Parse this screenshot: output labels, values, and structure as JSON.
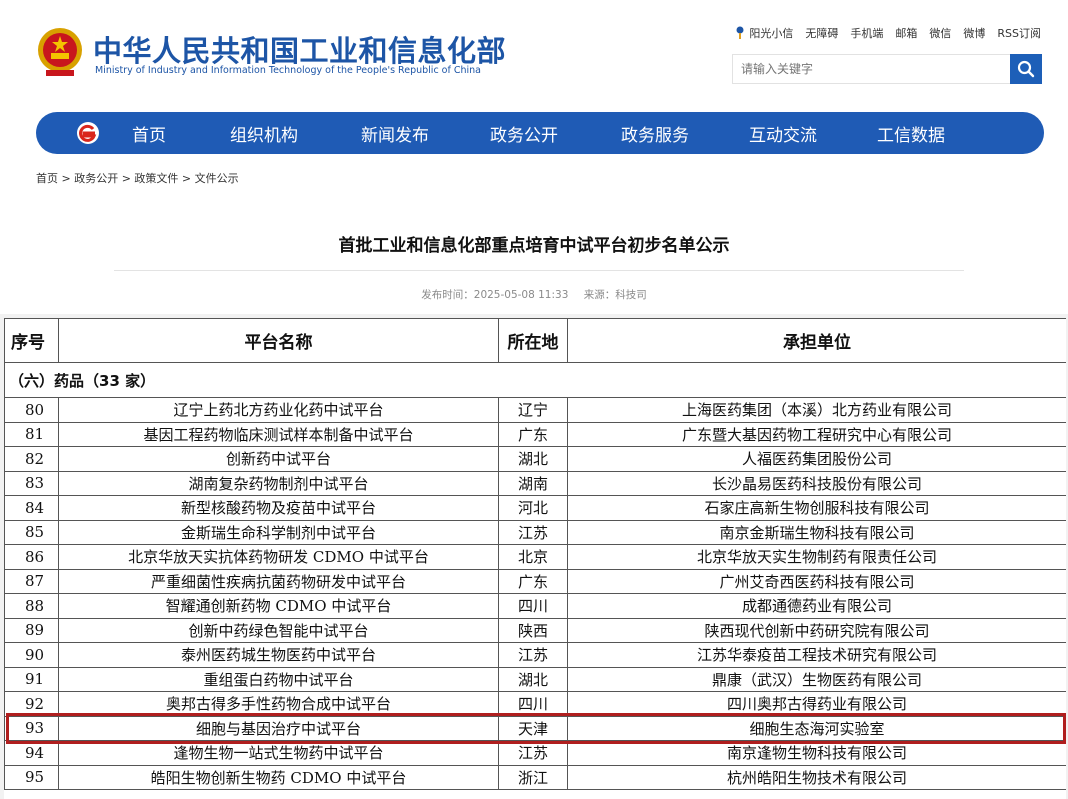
{
  "header": {
    "ministry_cn": "中华人民共和国工业和信息化部",
    "ministry_en": "Ministry of Industry and Information Technology of the People's Republic of China",
    "top_links": [
      "阳光小信",
      "无障碍",
      "手机端",
      "邮箱",
      "微信",
      "微博",
      "RSS订阅"
    ],
    "search": {
      "placeholder": "请输入关键字"
    }
  },
  "nav": {
    "items": [
      "首页",
      "组织机构",
      "新闻发布",
      "政务公开",
      "政务服务",
      "互动交流",
      "工信数据"
    ]
  },
  "breadcrumb": "首页 > 政务公开 > 政策文件 > 文件公示",
  "article": {
    "title": "首批工业和信息化部重点培育中试平台初步名单公示",
    "published": "发布时间：2025-05-08 11:33",
    "source": "来源：科技司"
  },
  "table": {
    "headers": [
      "序号",
      "平台名称",
      "所在地",
      "承担单位"
    ],
    "section": "（六）药品（33 家）",
    "rows": [
      {
        "no": "80",
        "name": "辽宁上药北方药业化药中试平台",
        "loc": "辽宁",
        "org": "上海医药集团（本溪）北方药业有限公司"
      },
      {
        "no": "81",
        "name": "基因工程药物临床测试样本制备中试平台",
        "loc": "广东",
        "org": "广东暨大基因药物工程研究中心有限公司"
      },
      {
        "no": "82",
        "name": "创新药中试平台",
        "loc": "湖北",
        "org": "人福医药集团股份公司"
      },
      {
        "no": "83",
        "name": "湖南复杂药物制剂中试平台",
        "loc": "湖南",
        "org": "长沙晶易医药科技股份有限公司"
      },
      {
        "no": "84",
        "name": "新型核酸药物及疫苗中试平台",
        "loc": "河北",
        "org": "石家庄高新生物创服科技有限公司"
      },
      {
        "no": "85",
        "name": "金斯瑞生命科学制剂中试平台",
        "loc": "江苏",
        "org": "南京金斯瑞生物科技有限公司"
      },
      {
        "no": "86",
        "name": "北京华放天实抗体药物研发 CDMO 中试平台",
        "loc": "北京",
        "org": "北京华放天实生物制药有限责任公司"
      },
      {
        "no": "87",
        "name": "严重细菌性疾病抗菌药物研发中试平台",
        "loc": "广东",
        "org": "广州艾奇西医药科技有限公司"
      },
      {
        "no": "88",
        "name": "智耀通创新药物 CDMO 中试平台",
        "loc": "四川",
        "org": "成都通德药业有限公司"
      },
      {
        "no": "89",
        "name": "创新中药绿色智能中试平台",
        "loc": "陕西",
        "org": "陕西现代创新中药研究院有限公司"
      },
      {
        "no": "90",
        "name": "泰州医药城生物医药中试平台",
        "loc": "江苏",
        "org": "江苏华泰疫苗工程技术研究有限公司"
      },
      {
        "no": "91",
        "name": "重组蛋白药物中试平台",
        "loc": "湖北",
        "org": "鼎康（武汉）生物医药有限公司"
      },
      {
        "no": "92",
        "name": "奥邦古得多手性药物合成中试平台",
        "loc": "四川",
        "org": "四川奥邦古得药业有限公司"
      },
      {
        "no": "93",
        "name": "细胞与基因治疗中试平台",
        "loc": "天津",
        "org": "细胞生态海河实验室"
      },
      {
        "no": "94",
        "name": "逢物生物一站式生物药中试平台",
        "loc": "江苏",
        "org": "南京逢物生物科技有限公司"
      },
      {
        "no": "95",
        "name": "皓阳生物创新生物药 CDMO 中试平台",
        "loc": "浙江",
        "org": "杭州皓阳生物技术有限公司"
      }
    ],
    "highlighted_no": "93"
  },
  "colors": {
    "brand_blue": "#1f5bb5",
    "highlight_red": "#b01e1e"
  },
  "icons": {
    "emblem": "national-emblem-icon",
    "search": "search-icon",
    "nav_logo": "ministry-logo-icon",
    "top": "sun-icon"
  }
}
